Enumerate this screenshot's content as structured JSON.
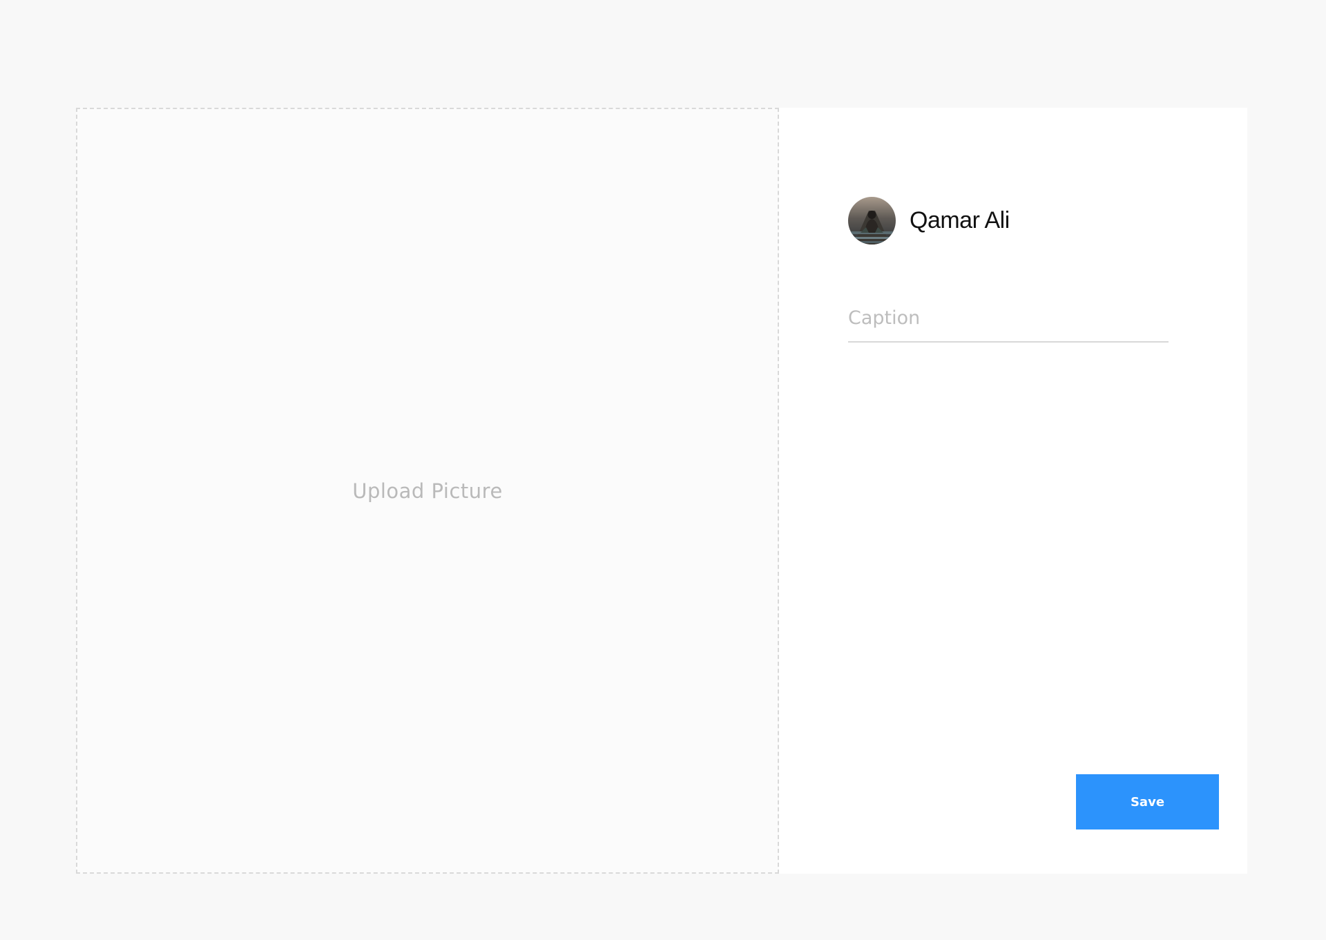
{
  "upload": {
    "label": "Upload Picture"
  },
  "user": {
    "name": "Qamar Ali",
    "avatar_icon": "user-avatar-photo"
  },
  "caption": {
    "placeholder": "Caption",
    "value": ""
  },
  "actions": {
    "save_label": "Save"
  },
  "colors": {
    "page_background": "#f8f8f8",
    "accent": "#2c93fc",
    "placeholder_text": "#bdbdbd",
    "dashed_border": "#d9d9d9"
  }
}
